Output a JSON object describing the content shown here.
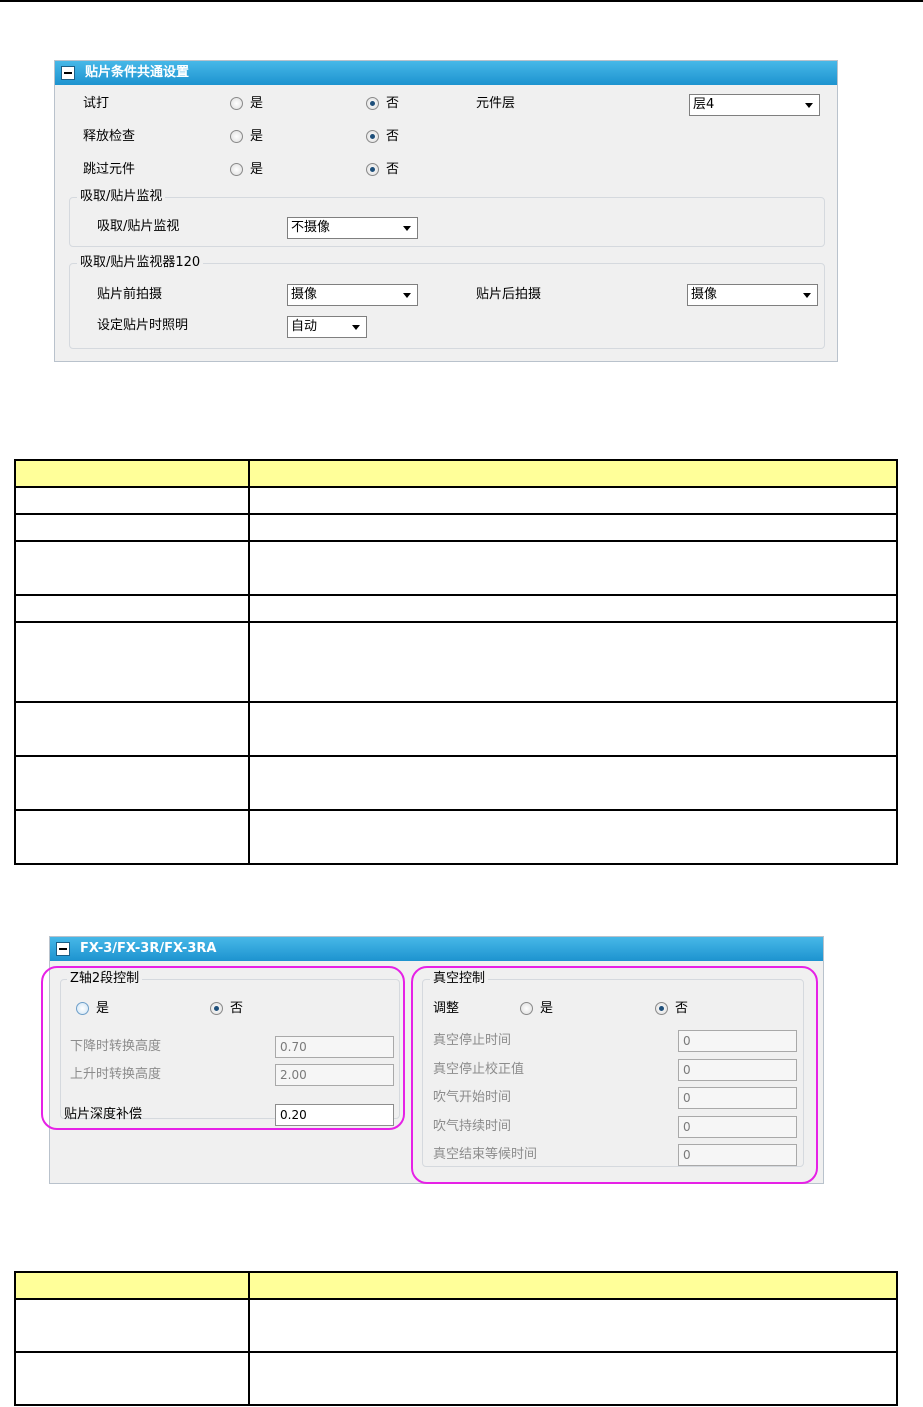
{
  "panel1": {
    "title": "贴片条件共通设置",
    "rows": [
      {
        "label": "试打",
        "yes": "是",
        "no": "否",
        "selected": "no"
      },
      {
        "label": "释放检查",
        "yes": "是",
        "no": "否",
        "selected": "no"
      },
      {
        "label": "跳过元件",
        "yes": "是",
        "no": "否",
        "selected": "no"
      }
    ],
    "layer": {
      "label": "元件层",
      "value": "层4"
    },
    "monitor_group": {
      "legend": "吸取/贴片监视",
      "label": "吸取/贴片监视",
      "value": "不摄像"
    },
    "monitor120_group": {
      "legend": "吸取/贴片监视器120",
      "before_label": "贴片前拍摄",
      "before_value": "摄像",
      "after_label": "贴片后拍摄",
      "after_value": "摄像",
      "lighting_label": "设定贴片时照明",
      "lighting_value": "自动"
    }
  },
  "panel2": {
    "title": "FX-3/FX-3R/FX-3RA",
    "z_axis": {
      "legend": "Z轴2段控制",
      "yes": "是",
      "no": "否",
      "selected": "no",
      "down_label": "下降时转换高度",
      "down_value": "0.70",
      "up_label": "上升时转换高度",
      "up_value": "2.00"
    },
    "depth": {
      "label": "贴片深度补偿",
      "value": "0.20"
    },
    "vacuum": {
      "legend": "真空控制",
      "adjust_label": "调整",
      "yes": "是",
      "no": "否",
      "selected": "no",
      "fields": [
        {
          "label": "真空停止时间",
          "value": "0"
        },
        {
          "label": "真空停止校正值",
          "value": "0"
        },
        {
          "label": "吹气开始时间",
          "value": "0"
        },
        {
          "label": "吹气持续时间",
          "value": "0"
        },
        {
          "label": "真空结束等候时间",
          "value": "0"
        }
      ]
    }
  },
  "colors": {
    "header_blue": "#1d93cf",
    "table_header": "#ffff99",
    "highlight": "#e621e6"
  }
}
